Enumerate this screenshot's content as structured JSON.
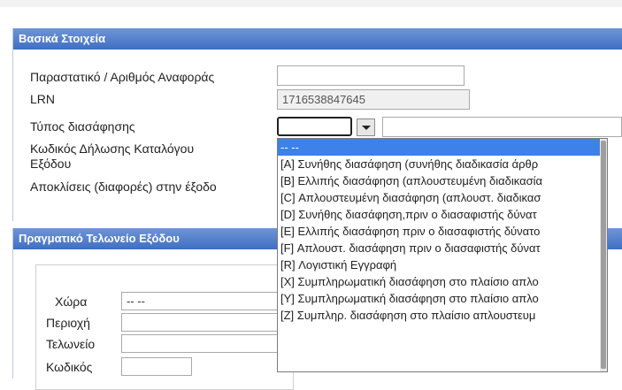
{
  "panel_basic": {
    "title": "Βασικά Στοιχεία",
    "fields": {
      "reference_label": "Παραστατικό / Αριθμός Αναφοράς",
      "reference_value": "",
      "lrn_label": "LRN",
      "lrn_value": "1716538847645",
      "clearance_type_label": "Τύπος διασάφησης",
      "exit_catalog_label_line1": "Κωδικός Δήλωσης Καταλόγου",
      "exit_catalog_label_line2": "Εξόδου",
      "deviations_label": "Αποκλίσεις (διαφορές) στην έξοδο"
    }
  },
  "clearance_dropdown": {
    "selected_index": 0,
    "options": [
      "-- --",
      "[A] Συνήθης διασάφηση (συνήθης διαδικασία άρθρ",
      "[B] Ελλιπής διασάφηση (απλουστευμένη διαδικασία",
      "[C] Απλουστευμένη διασάφηση (απλουστ. διαδικασ",
      "[D] Συνήθης διασάφηση,πριν ο διασαφιστής δύνατ",
      "[E] Ελλιπής διασάφηση πριν ο διασαφιστής δύνατο",
      "[F] Απλουστ. διασάφηση πριν ο διασαφιστής δύνατ",
      "[R] Λογιστική Εγγραφή",
      "[X] Συμπληρωματική διασάφηση στο πλαίσιο απλο",
      "[Y] Συμπληρωματική διασάφηση στο πλαίσιο απλο",
      "[Z] Συμπληρ. διασάφηση στο πλαίσιο απλουστευμ"
    ]
  },
  "panel_exit_office": {
    "title": "Πραγματικό Τελωνείο Εξόδου",
    "fields": {
      "country_label": "Χώρα",
      "country_value": "-- --",
      "region_label": "Περιοχή",
      "customs_label": "Τελωνείο",
      "code_label": "Κωδικός"
    }
  },
  "colors": {
    "header_gradient_top": "#6f95d6",
    "header_gradient_bottom": "#3f6fc3",
    "selected_option": "#3c82e8"
  }
}
